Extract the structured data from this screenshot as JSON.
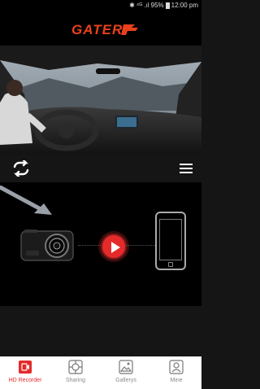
{
  "status_bar": {
    "bluetooth_icon": "bluetooth-icon",
    "signal_text": "⁴ᴳ .ıl",
    "battery_percent": "95%",
    "time": "12:00 pm"
  },
  "logo": {
    "text": "GATER",
    "color": "#e8401c"
  },
  "controls": {
    "left_icon": "switch-camera-icon",
    "right_icon": "menu-icon"
  },
  "connect": {
    "accent": "#e52a2a",
    "source": "dashcam-icon",
    "target": "phone-icon"
  },
  "tabs": [
    {
      "label": "HD Recorder",
      "icon": "recorder-icon",
      "active": true
    },
    {
      "label": "Sharing",
      "icon": "sharing-icon",
      "active": false
    },
    {
      "label": "Gallerys",
      "icon": "gallery-icon",
      "active": false
    },
    {
      "label": "Mine",
      "icon": "profile-icon",
      "active": false
    }
  ]
}
